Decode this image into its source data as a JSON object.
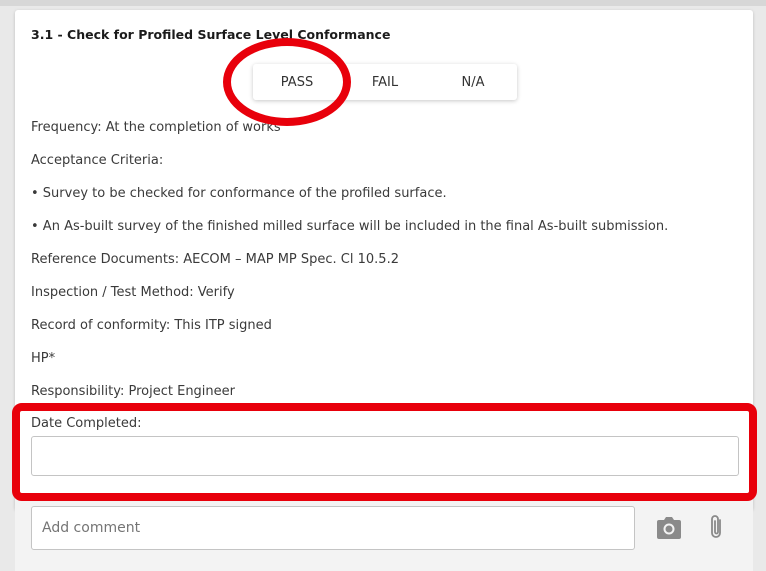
{
  "item": {
    "title": "3.1 - Check for Profiled Surface Level Conformance",
    "options": [
      "PASS",
      "FAIL",
      "N/A"
    ],
    "lines": [
      "Frequency: At the completion of works",
      "Acceptance Criteria:",
      "• Survey to be checked for conformance of the profiled surface.",
      "• An As-built survey of the finished milled surface will be included in the final As-built submission.",
      "Reference Documents: AECOM – MAP MP Spec. Cl 10.5.2",
      "Inspection / Test Method: Verify",
      "Record of conformity: This ITP signed",
      "HP*",
      "Responsibility: Project Engineer"
    ],
    "date_label": "Date Completed:",
    "date_value": ""
  },
  "comment": {
    "placeholder": "Add comment",
    "camera_icon": "camera-icon",
    "attach_icon": "paperclip-icon"
  },
  "annotation_color": "#e8000b"
}
